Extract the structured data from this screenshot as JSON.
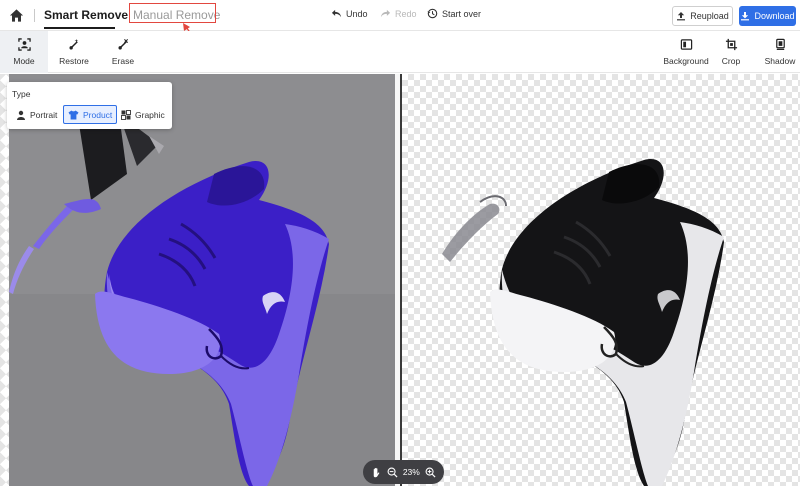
{
  "header": {
    "tab_smart": "Smart Remove",
    "tab_manual": "Manual Remove",
    "undo": "Undo",
    "redo": "Redo",
    "start_over": "Start over",
    "reupload": "Reupload",
    "download": "Download"
  },
  "tools": {
    "mode": "Mode",
    "restore": "Restore",
    "erase": "Erase",
    "background": "Background",
    "crop": "Crop",
    "shadow": "Shadow"
  },
  "type_panel": {
    "title": "Type",
    "options": [
      "Portrait",
      "Product",
      "Graphic"
    ],
    "selected": "Product"
  },
  "zoom": {
    "level": "23%"
  },
  "colors": {
    "accent": "#2f6fe6",
    "annotation": "#e2473f",
    "mask": "#3b1fc7",
    "mask_light": "#7b67e8"
  },
  "icons": [
    "home-icon",
    "undo-icon",
    "redo-icon",
    "history-icon",
    "upload-icon",
    "download-icon",
    "mode-icon",
    "restore-icon",
    "erase-icon",
    "background-icon",
    "crop-icon",
    "shadow-icon",
    "portrait-icon",
    "product-icon",
    "graphic-icon",
    "hand-icon",
    "zoom-out-icon",
    "zoom-in-icon"
  ]
}
